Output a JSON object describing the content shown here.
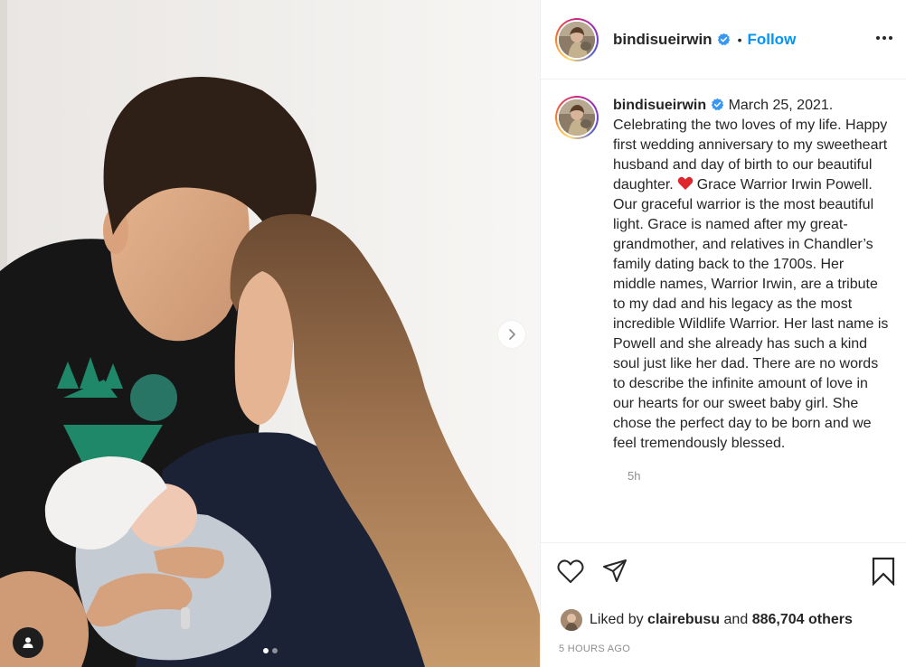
{
  "post": {
    "username": "bindisueirwin",
    "follow_label": "Follow",
    "header_separator": "•",
    "caption": {
      "date": "March 25, 2021.",
      "text_part1": "Celebrating the two loves of my life. Happy first wedding anniversary to my sweetheart husband and day of birth to our beautiful daughter.",
      "emoji": "red-heart",
      "text_part2": "Grace Warrior Irwin Powell. Our graceful warrior is the most beautiful light. Grace is named after my great-grandmother, and relatives in Chandler’s family dating back to the 1700s. Her middle names, Warrior Irwin, are a tribute to my dad and his legacy as the most incredible Wildlife Warrior. Her last name is Powell and she already has such a kind soul just like her dad. There are no words to describe the infinite amount of love in our hearts for our sweet baby girl. She chose the perfect day to be born and we feel tremendously blessed."
    },
    "time_ago": "5h",
    "likes": {
      "prefix": "Liked by",
      "user": "clairebusu",
      "connector": "and",
      "others": "886,704 others"
    },
    "posted_time": "5 HOURS AGO",
    "carousel": {
      "total": 2,
      "active_index": 0
    }
  },
  "icons": {
    "verified": "verified-badge-icon",
    "more": "more-options-icon",
    "like": "heart-icon",
    "share": "paper-plane-icon",
    "save": "bookmark-icon",
    "next": "chevron-right-icon",
    "tag": "user-tag-icon"
  },
  "colors": {
    "accent": "#0095f6",
    "text": "#262626",
    "muted": "#8e8e8e",
    "verified": "#3897f0"
  }
}
